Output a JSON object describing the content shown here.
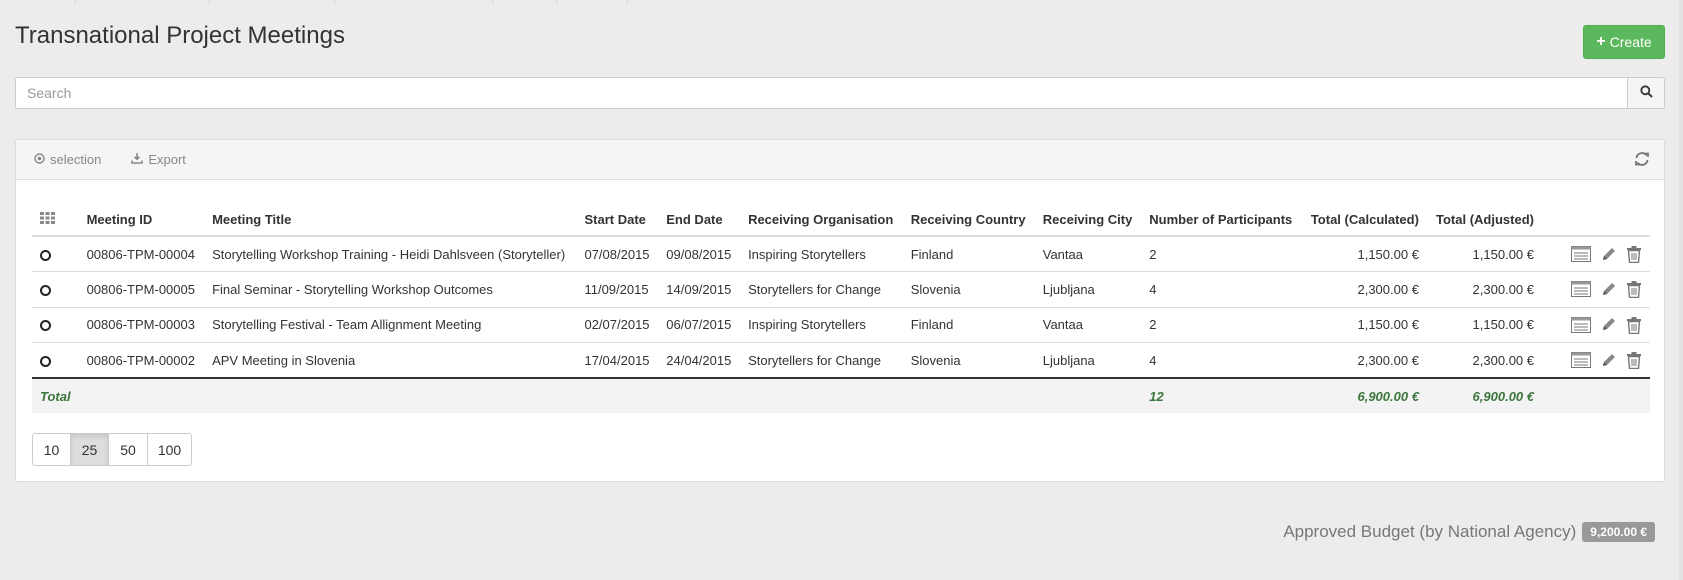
{
  "page": {
    "title": "Transnational Project Meetings"
  },
  "toolbar": {
    "create_label": "Create",
    "selection_label": "selection",
    "export_label": "Export"
  },
  "search": {
    "placeholder": "Search"
  },
  "table": {
    "columns": [
      "Meeting ID",
      "Meeting Title",
      "Start Date",
      "End Date",
      "Receiving Organisation",
      "Receiving Country",
      "Receiving City",
      "Number of Participants",
      "Total (Calculated)",
      "Total (Adjusted)"
    ],
    "rows": [
      {
        "id": "00806-TPM-00004",
        "title": "Storytelling Workshop Training - Heidi Dahlsveen (Storyteller)",
        "start": "07/08/2015",
        "end": "09/08/2015",
        "org": "Inspiring Storytellers",
        "country": "Finland",
        "city": "Vantaa",
        "participants": "2",
        "calculated": "1,150.00 €",
        "adjusted": "1,150.00 €"
      },
      {
        "id": "00806-TPM-00005",
        "title": "Final Seminar - Storytelling Workshop Outcomes",
        "start": "11/09/2015",
        "end": "14/09/2015",
        "org": "Storytellers for Change",
        "country": "Slovenia",
        "city": "Ljubljana",
        "participants": "4",
        "calculated": "2,300.00 €",
        "adjusted": "2,300.00 €"
      },
      {
        "id": "00806-TPM-00003",
        "title": "Storytelling Festival - Team Allignment Meeting",
        "start": "02/07/2015",
        "end": "06/07/2015",
        "org": "Inspiring Storytellers",
        "country": "Finland",
        "city": "Vantaa",
        "participants": "2",
        "calculated": "1,150.00 €",
        "adjusted": "1,150.00 €"
      },
      {
        "id": "00806-TPM-00002",
        "title": "APV Meeting in Slovenia",
        "start": "17/04/2015",
        "end": "24/04/2015",
        "org": "Storytellers for Change",
        "country": "Slovenia",
        "city": "Ljubljana",
        "participants": "4",
        "calculated": "2,300.00 €",
        "adjusted": "2,300.00 €"
      }
    ],
    "footer": {
      "label": "Total",
      "participants": "12",
      "calculated": "6,900.00 €",
      "adjusted": "6,900.00 €"
    }
  },
  "pagination": {
    "sizes": [
      "10",
      "25",
      "50",
      "100"
    ],
    "active": "25"
  },
  "budget": {
    "label": "Approved Budget (by National Agency)",
    "value": "9,200.00 €"
  },
  "icons": {
    "create": "plus-icon",
    "search": "search-icon",
    "selection": "circle-dot-icon",
    "export": "download-icon",
    "refresh": "refresh-icon",
    "columns": "grid-icon",
    "row_view": "list-view-icon",
    "row_edit": "pencil-icon",
    "row_delete": "trash-icon"
  },
  "colors": {
    "create_button": "#5cb85c",
    "total_text": "#3c763d",
    "budget_badge": "#999999"
  }
}
